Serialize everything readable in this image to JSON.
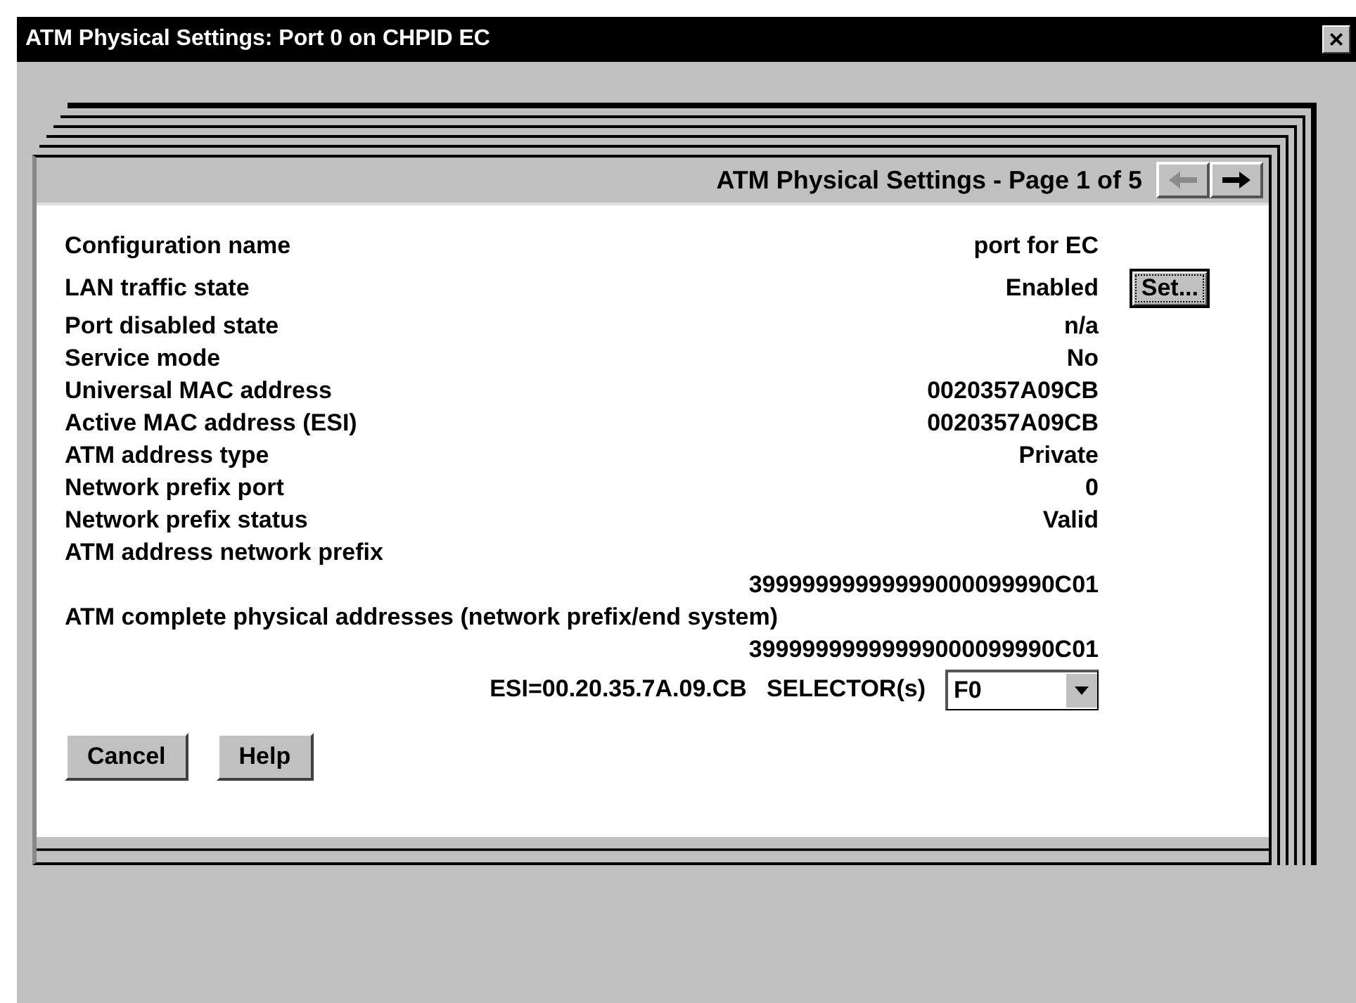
{
  "window": {
    "title": "ATM Physical Settings: Port 0 on CHPID EC",
    "close": "×"
  },
  "page_header": {
    "title": "ATM Physical Settings - Page 1 of 5",
    "prev_disabled": true,
    "next_disabled": false
  },
  "rows": [
    {
      "kind": "pair",
      "label": "Configuration name",
      "value": "port for EC"
    },
    {
      "kind": "pair",
      "label": "LAN traffic state",
      "value": "Enabled",
      "button": "Set..."
    },
    {
      "kind": "pair",
      "label": "Port disabled state",
      "value": "n/a"
    },
    {
      "kind": "pair",
      "label": "Service mode",
      "value": "No"
    },
    {
      "kind": "pair",
      "label": "Universal MAC address",
      "value": "0020357A09CB"
    },
    {
      "kind": "pair",
      "label": "Active MAC address (ESI)",
      "value": "0020357A09CB"
    },
    {
      "kind": "pair",
      "label": "ATM address type",
      "value": "Private"
    },
    {
      "kind": "pair",
      "label": "Network prefix port",
      "value": "0"
    },
    {
      "kind": "pair",
      "label": "Network prefix status",
      "value": "Valid"
    },
    {
      "kind": "label",
      "label": "ATM address network prefix"
    },
    {
      "kind": "value",
      "value": "39999999999999000099990C01"
    },
    {
      "kind": "label",
      "label": "ATM complete physical addresses (network prefix/end system)"
    },
    {
      "kind": "value",
      "value": "39999999999999000099990C01"
    }
  ],
  "esi": {
    "text": "ESI=00.20.35.7A.09.CB",
    "selector_label": "SELECTOR(s)",
    "selector_value": "F0"
  },
  "buttons": [
    "Cancel",
    "Help"
  ]
}
